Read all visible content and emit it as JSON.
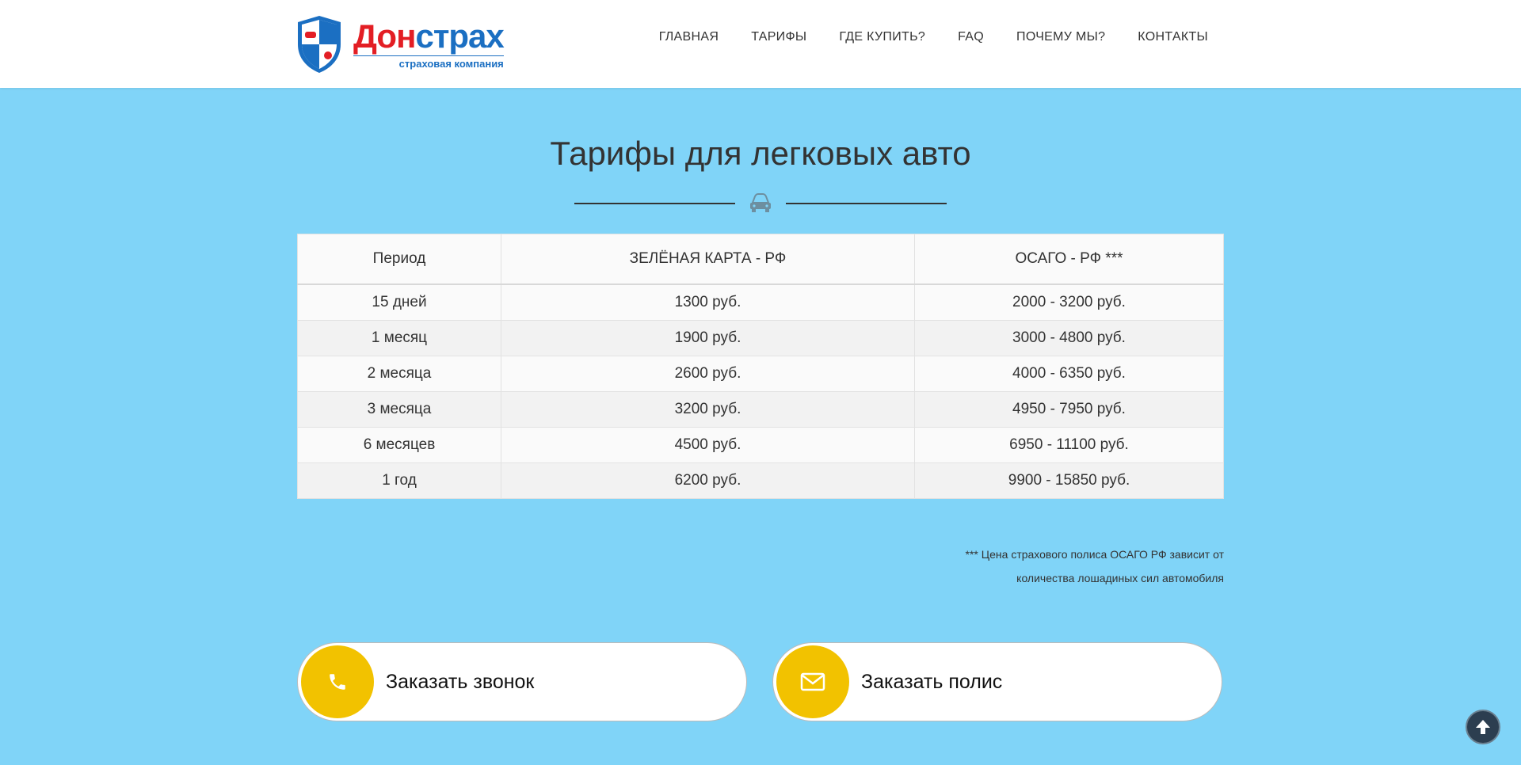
{
  "brand": {
    "name_part1": "Дон",
    "name_part2": "страх",
    "tagline": "страховая компания",
    "red": "#e31e24",
    "blue": "#1b6fc2"
  },
  "nav": {
    "items": [
      "ГЛАВНАЯ",
      "ТАРИФЫ",
      "ГДЕ КУПИТЬ?",
      "FAQ",
      "ПОЧЕМУ МЫ?",
      "КОНТАКТЫ"
    ]
  },
  "section": {
    "title": "Тарифы для легковых авто",
    "divider_icon": "car-icon"
  },
  "table": {
    "headers": [
      "Период",
      "ЗЕЛЁНАЯ КАРТА - РФ",
      "ОСАГО - РФ ***"
    ],
    "rows": [
      [
        "15 дней",
        "1300 руб.",
        "2000 - 3200 руб."
      ],
      [
        "1 месяц",
        "1900 руб.",
        "3000 - 4800 руб."
      ],
      [
        "2 месяца",
        "2600 руб.",
        "4000 - 6350 руб."
      ],
      [
        "3 месяца",
        "3200 руб.",
        "4950 - 7950 руб."
      ],
      [
        "6 месяцев",
        "4500 руб.",
        "6950 - 11100 руб."
      ],
      [
        "1 год",
        "6200 руб.",
        "9900 - 15850 руб."
      ]
    ]
  },
  "note": {
    "line1": "*** Цена страхового полиса ОСАГО РФ зависит от",
    "line2": "количества лошадиных сил автомобиля"
  },
  "cta": {
    "call_label": "Заказать звонок",
    "call_icon": "phone-icon",
    "order_label": "Заказать полис",
    "order_icon": "envelope-icon",
    "accent": "#f2c200"
  },
  "scroll_top_icon": "arrow-up-icon",
  "colors": {
    "background": "#80d4f8",
    "header": "#ffffff"
  }
}
